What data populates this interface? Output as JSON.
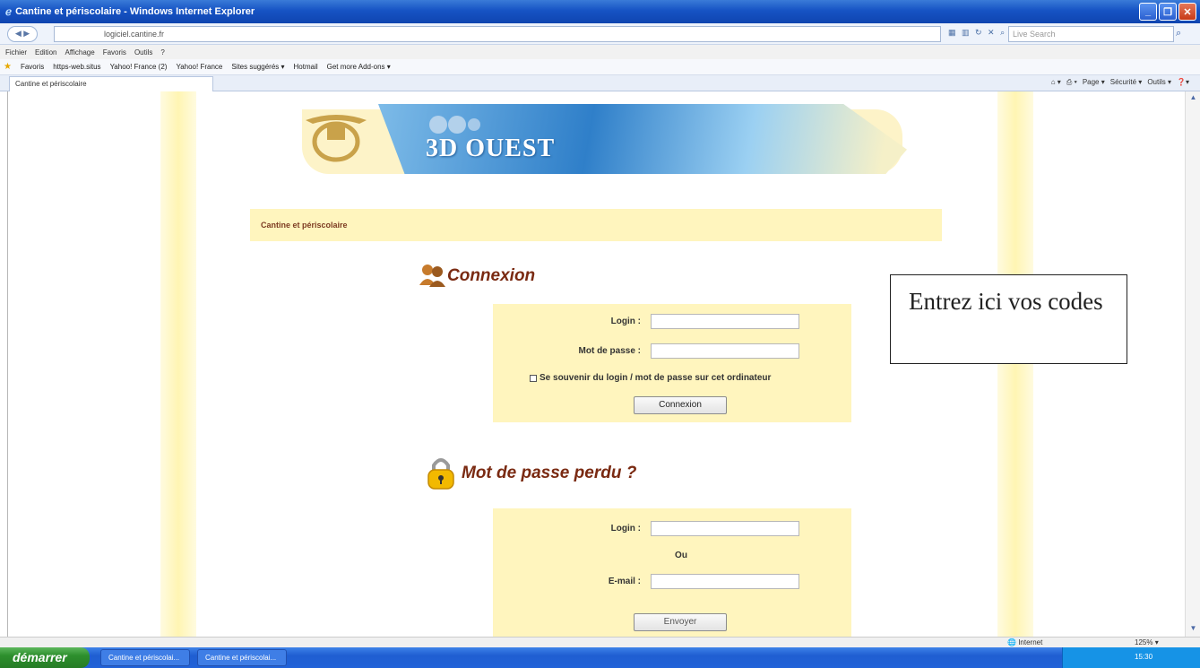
{
  "window": {
    "title": "Cantine et périscolaire - Windows Internet Explorer"
  },
  "address_bar": {
    "url": "logiciel.cantine.fr",
    "search_placeholder": "Live Search"
  },
  "menu": {
    "items": [
      "Fichier",
      "Edition",
      "Affichage",
      "Favoris",
      "Outils",
      "?"
    ]
  },
  "favorites": {
    "items": [
      "Favoris",
      "https-web.situs",
      "Yahoo! France (2)",
      "Yahoo! France",
      "Sites suggérés ▾",
      "Hotmail",
      "Get more Add-ons ▾"
    ]
  },
  "tab": {
    "label": "Cantine et périscolaire"
  },
  "command_bar": {
    "items": [
      "Page ▾",
      "Sécurité ▾",
      "Outils ▾"
    ]
  },
  "page": {
    "banner_text": "3D OUEST",
    "app_title": "Cantine et périscolaire",
    "login_section": {
      "title": "Connexion",
      "login_label": "Login :",
      "password_label": "Mot de passe :",
      "remember_label": "Se souvenir du login / mot de passe sur cet ordinateur",
      "submit_label": "Connexion"
    },
    "lost_password_section": {
      "title": "Mot de passe perdu ?",
      "login_label": "Login :",
      "or_label": "Ou",
      "email_label": "E-mail :",
      "submit_label": "Envoyer"
    },
    "note": {
      "text": "Entrez ici vos codes"
    }
  },
  "status_bar": {
    "zone": "Internet",
    "zoom": "125%"
  },
  "taskbar": {
    "start_label": "démarrer",
    "tasks": [
      "Cantine et périscolai...",
      "Cantine et périscolai..."
    ],
    "clock": "15:30"
  }
}
